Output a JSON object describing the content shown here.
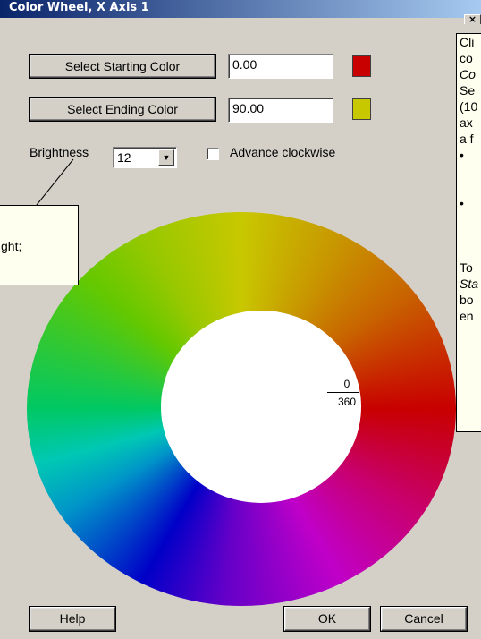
{
  "window": {
    "title": "Color Wheel, X Axis 1",
    "close_glyph": "×"
  },
  "start": {
    "button_label": "Select Starting Color",
    "value": "0.00",
    "swatch_color": "#c80000"
  },
  "end": {
    "button_label": "Select Ending Color",
    "value": "90.00",
    "swatch_color": "#c8c800"
  },
  "brightness": {
    "label": "Brightness",
    "value": "12"
  },
  "advance": {
    "label": "Advance clockwise",
    "checked": false
  },
  "wheel": {
    "zero_label": "0",
    "end_label": "360"
  },
  "callout_left": {
    "lines": [
      "",
      "ght;"
    ]
  },
  "callout_right": {
    "lines": [
      "Cli",
      "co",
      "Co",
      "Se",
      "(10",
      "ax",
      "a f",
      "•",
      "",
      "",
      "•",
      "",
      "",
      "",
      "To",
      "Sta",
      "bo",
      "en"
    ]
  },
  "footer": {
    "help_label": "Help",
    "ok_label": "OK",
    "cancel_label": "Cancel"
  }
}
